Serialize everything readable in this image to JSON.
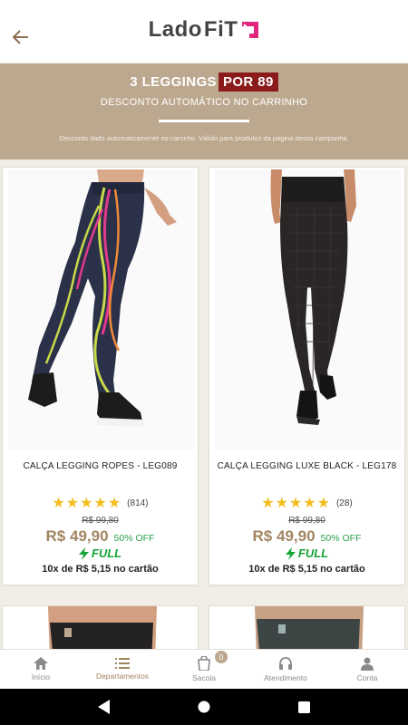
{
  "header": {
    "logo_text_lado": "Lado",
    "logo_text_fit": "FiT"
  },
  "promo": {
    "title_prefix": "3 LEGGINGS",
    "title_highlight": "POR 89",
    "subtitle": "DESCONTO AUTOMÁTICO NO CARRINHO",
    "note": "Desconto dado automaticamente no carrinho. Válido para produtos da página dessa campanha."
  },
  "products": [
    {
      "name": "CALÇA LEGGING ROPES - LEG089",
      "stars": "★★★★★",
      "rating_count": "(814)",
      "old_price": "R$ 99,80",
      "price": "R$ 49,90",
      "discount": "50% OFF",
      "shipping": "FULL",
      "installments": "10x de R$ 5,15 no cartão"
    },
    {
      "name": "CALÇA LEGGING LUXE BLACK - LEG178",
      "stars": "★★★★★",
      "rating_count": "(28)",
      "old_price": "R$ 99,80",
      "price": "R$ 49,90",
      "discount": "50% OFF",
      "shipping": "FULL",
      "installments": "10x de R$ 5,15 no cartão"
    }
  ],
  "nav": {
    "items": [
      {
        "label": "Início",
        "icon": "home-icon"
      },
      {
        "label": "Departamentos",
        "icon": "list-icon"
      },
      {
        "label": "Sacola",
        "icon": "bag-icon"
      },
      {
        "label": "Atendimento",
        "icon": "headset-icon"
      },
      {
        "label": "Conta",
        "icon": "user-icon"
      }
    ],
    "active": "Departamentos",
    "cart_count": "0"
  },
  "colors": {
    "brand_beige": "#bca88f",
    "price_gold": "#a18561",
    "promo_red": "#8b1a1a",
    "full_green": "#14a437",
    "star_yellow": "#f3bd1c",
    "logo_pink": "#e0267d"
  }
}
